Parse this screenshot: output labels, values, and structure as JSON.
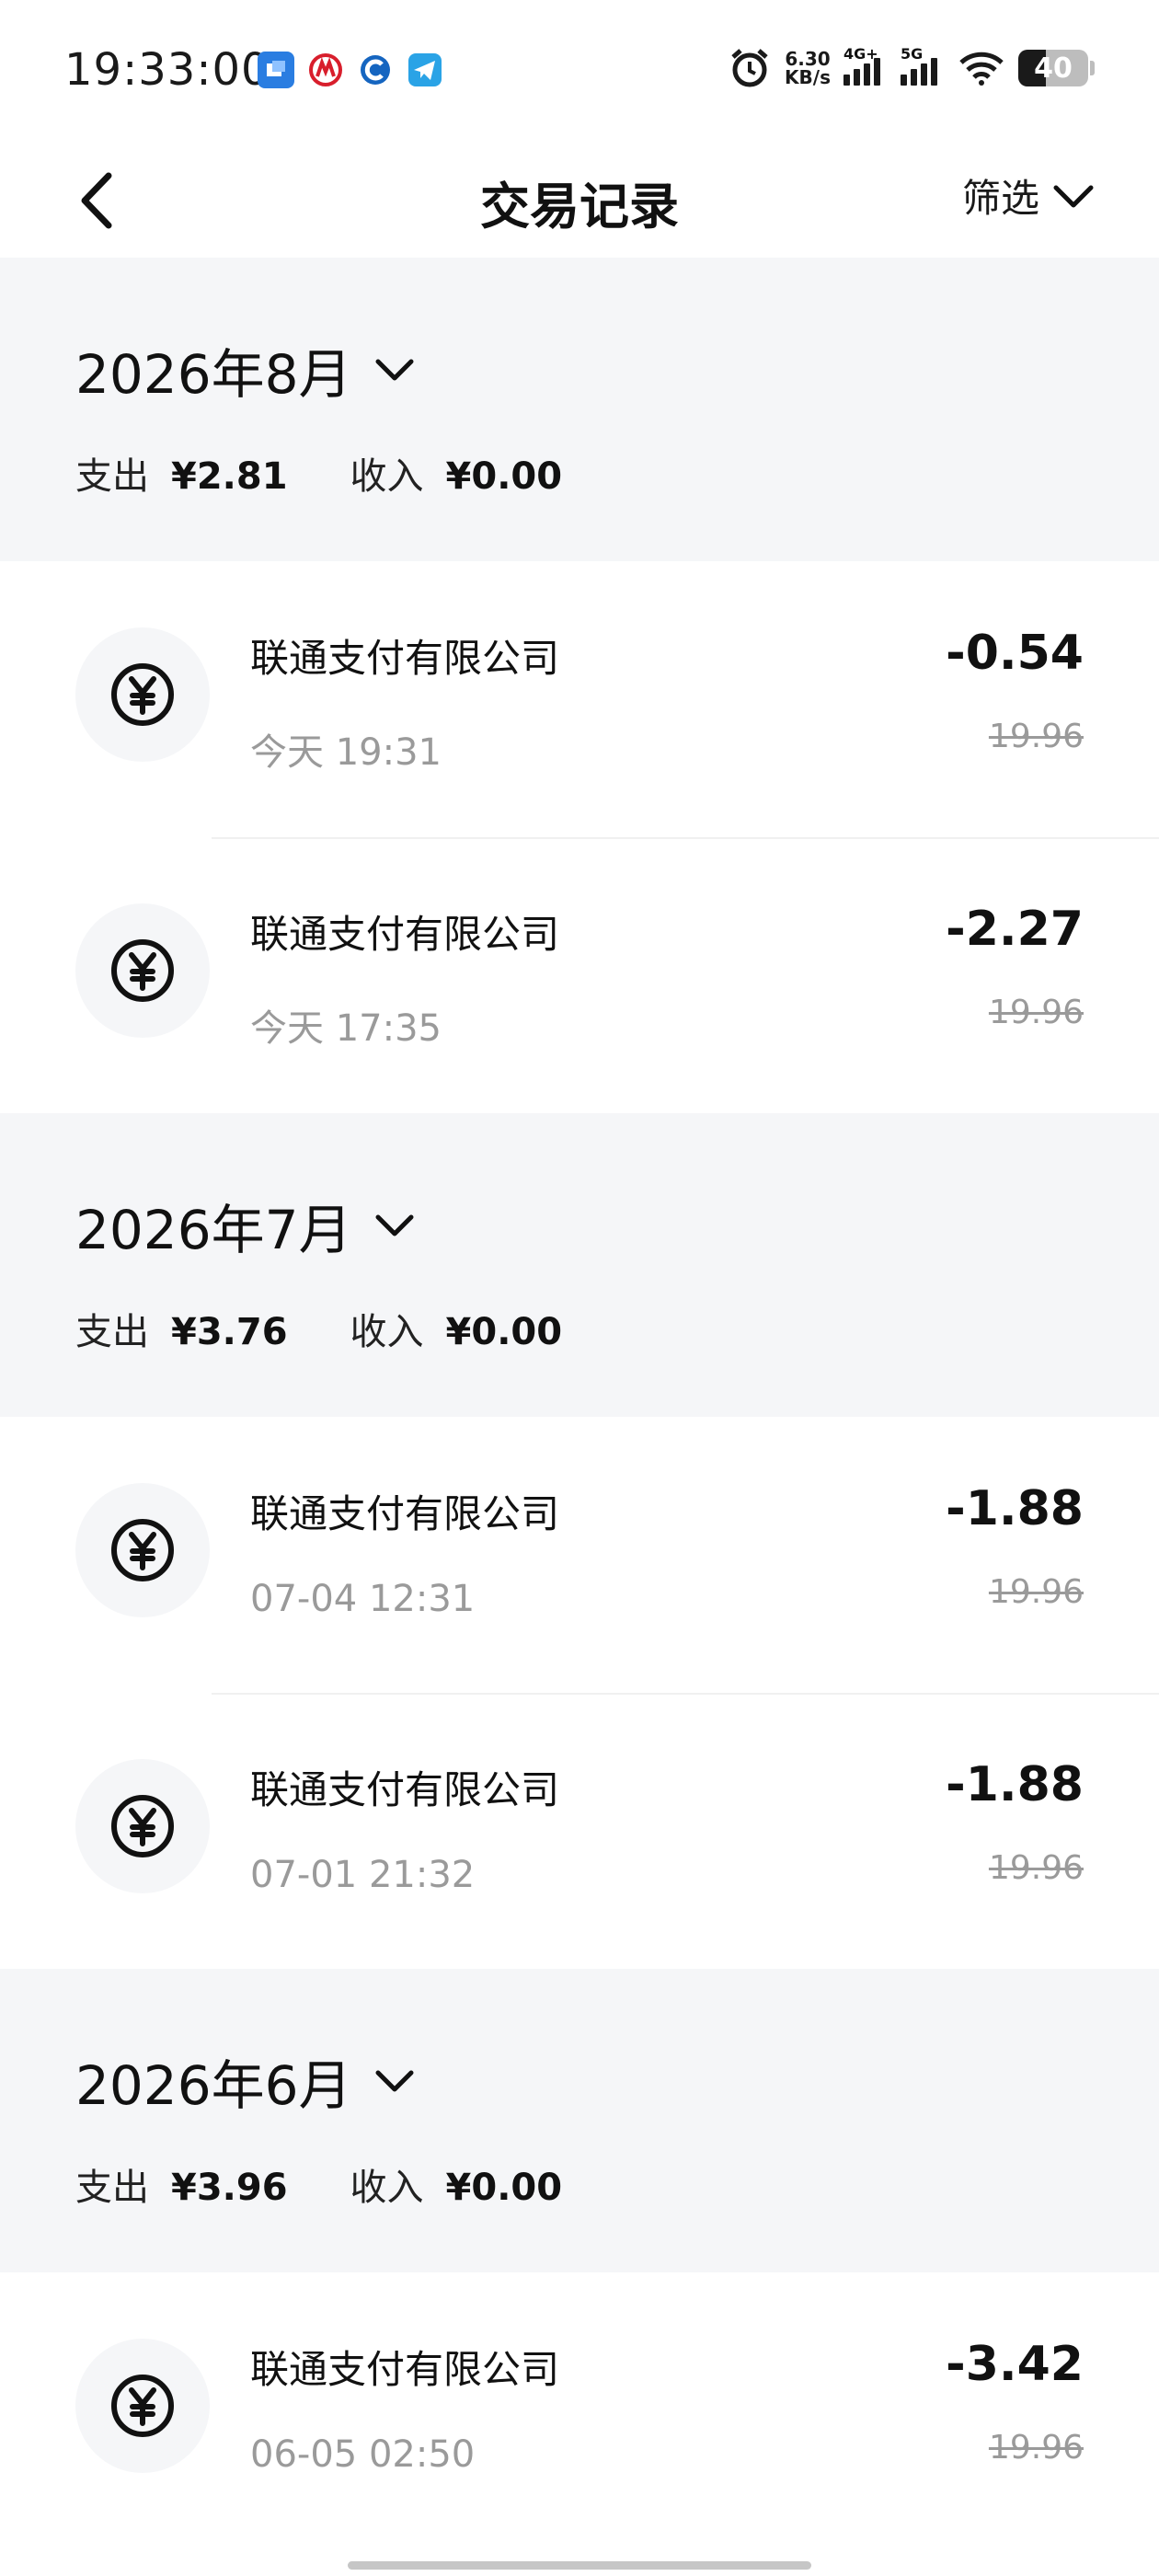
{
  "status_bar": {
    "time": "19:33:00",
    "net_speed_value": "6.30",
    "net_speed_unit": "KB/s",
    "signal1_label": "4G+",
    "signal2_label": "5G",
    "battery_level": "40",
    "battery_fraction": 0.4
  },
  "header": {
    "title": "交易记录",
    "filter_label": "筛选"
  },
  "months": [
    {
      "title": "2026年8月",
      "expense_label": "支出",
      "expense_value": "¥2.81",
      "income_label": "收入",
      "income_value": "¥0.00",
      "transactions": [
        {
          "name": "联通支付有限公司",
          "time": "今天 19:31",
          "amount": "-0.54",
          "original": "19.96"
        },
        {
          "name": "联通支付有限公司",
          "time": "今天 17:35",
          "amount": "-2.27",
          "original": "19.96"
        }
      ]
    },
    {
      "title": "2026年7月",
      "expense_label": "支出",
      "expense_value": "¥3.76",
      "income_label": "收入",
      "income_value": "¥0.00",
      "transactions": [
        {
          "name": "联通支付有限公司",
          "time": "07-04 12:31",
          "amount": "-1.88",
          "original": "19.96"
        },
        {
          "name": "联通支付有限公司",
          "time": "07-01 21:32",
          "amount": "-1.88",
          "original": "19.96"
        }
      ]
    },
    {
      "title": "2026年6月",
      "expense_label": "支出",
      "expense_value": "¥3.96",
      "income_label": "收入",
      "income_value": "¥0.00",
      "transactions": [
        {
          "name": "联通支付有限公司",
          "time": "06-05 02:50",
          "amount": "-3.42",
          "original": "19.96"
        }
      ]
    }
  ],
  "icons": {
    "back": "back-arrow-icon",
    "filter": "chevron-down-icon",
    "month_toggle": "chevron-down-icon",
    "transaction": "yuan-coin-icon"
  },
  "colors": {
    "section_bg": "#f5f6f8",
    "secondary_text": "#9a9a9a",
    "primary_text": "#111111"
  }
}
